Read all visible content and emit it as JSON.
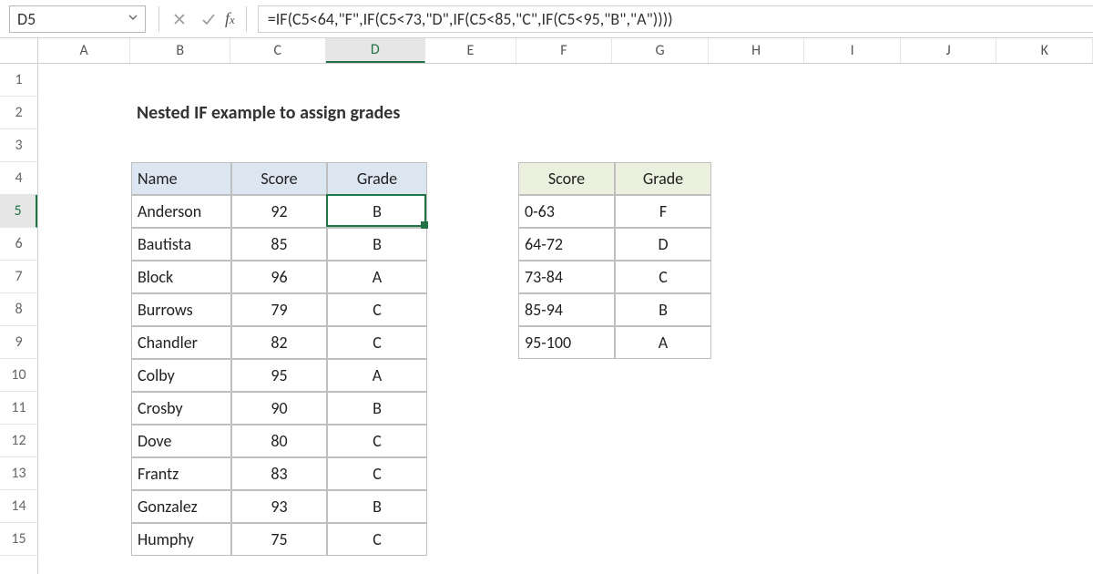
{
  "namebox": {
    "value": "D5"
  },
  "formula": "=IF(C5<64,\"F\",IF(C5<73,\"D\",IF(C5<85,\"C\",IF(C5<95,\"B\",\"A\"))))",
  "columns": [
    "A",
    "B",
    "C",
    "D",
    "E",
    "F",
    "G",
    "H",
    "I",
    "J",
    "K"
  ],
  "col_widths": {
    "A": 102,
    "B": 110,
    "C": 105,
    "D": 110,
    "E": 100,
    "F": 106,
    "G": 106,
    "H": 106,
    "I": 106,
    "J": 106,
    "K": 106
  },
  "active_col": "D",
  "rows": [
    1,
    2,
    3,
    4,
    5,
    6,
    7,
    8,
    9,
    10,
    11,
    12,
    13,
    14,
    15
  ],
  "active_row": 5,
  "title": "Nested IF example to assign grades",
  "main_table": {
    "headers": {
      "name": "Name",
      "score": "Score",
      "grade": "Grade"
    },
    "rows": [
      {
        "name": "Anderson",
        "score": 92,
        "grade": "B"
      },
      {
        "name": "Bautista",
        "score": 85,
        "grade": "B"
      },
      {
        "name": "Block",
        "score": 96,
        "grade": "A"
      },
      {
        "name": "Burrows",
        "score": 79,
        "grade": "C"
      },
      {
        "name": "Chandler",
        "score": 82,
        "grade": "C"
      },
      {
        "name": "Colby",
        "score": 95,
        "grade": "A"
      },
      {
        "name": "Crosby",
        "score": 90,
        "grade": "B"
      },
      {
        "name": "Dove",
        "score": 80,
        "grade": "C"
      },
      {
        "name": "Frantz",
        "score": 83,
        "grade": "C"
      },
      {
        "name": "Gonzalez",
        "score": 93,
        "grade": "B"
      },
      {
        "name": "Humphy",
        "score": 75,
        "grade": "C"
      }
    ]
  },
  "lookup_table": {
    "headers": {
      "score": "Score",
      "grade": "Grade"
    },
    "rows": [
      {
        "score": "0-63",
        "grade": "F"
      },
      {
        "score": "64-72",
        "grade": "D"
      },
      {
        "score": "73-84",
        "grade": "C"
      },
      {
        "score": "85-94",
        "grade": "B"
      },
      {
        "score": "95-100",
        "grade": "A"
      }
    ]
  }
}
